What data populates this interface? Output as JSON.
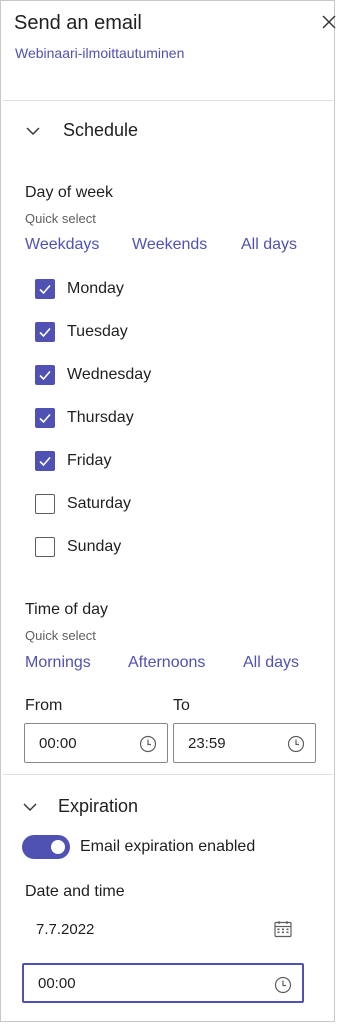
{
  "header": {
    "title": "Send an email",
    "subtitle": "Webinaari-ilmoittautuminen"
  },
  "schedule": {
    "title": "Schedule",
    "day_of_week": {
      "label": "Day of week",
      "quick_select": "Quick select",
      "links": [
        "Weekdays",
        "Weekends",
        "All days"
      ],
      "days": [
        {
          "label": "Monday",
          "checked": true
        },
        {
          "label": "Tuesday",
          "checked": true
        },
        {
          "label": "Wednesday",
          "checked": true
        },
        {
          "label": "Thursday",
          "checked": true
        },
        {
          "label": "Friday",
          "checked": true
        },
        {
          "label": "Saturday",
          "checked": false
        },
        {
          "label": "Sunday",
          "checked": false
        }
      ]
    },
    "time_of_day": {
      "label": "Time of day",
      "quick_select": "Quick select",
      "links": [
        "Mornings",
        "Afternoons",
        "All days"
      ],
      "from_label": "From",
      "to_label": "To",
      "from_value": "00:00",
      "to_value": "23:59"
    }
  },
  "expiration": {
    "title": "Expiration",
    "toggle_label": "Email expiration enabled",
    "toggle_on": true,
    "date_time_label": "Date and time",
    "date_value": "7.7.2022",
    "time_value": "00:00"
  },
  "colors": {
    "accent": "#4f52b2",
    "text": "#201f1e",
    "muted": "#605e5c"
  }
}
